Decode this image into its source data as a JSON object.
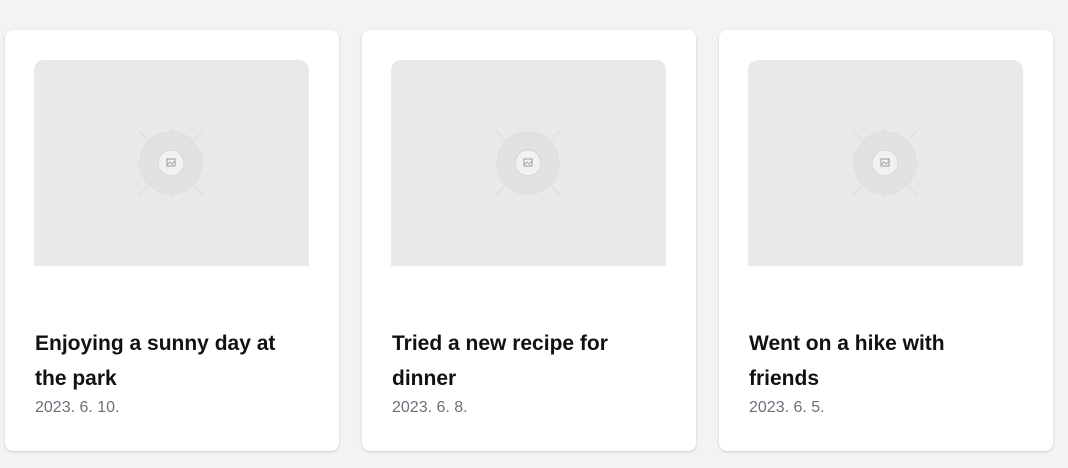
{
  "posts": [
    {
      "title": "Enjoying a sunny day at the park",
      "date": "2023. 6. 10.",
      "image_icon": "image-placeholder-icon"
    },
    {
      "title": "Tried a new recipe for dinner",
      "date": "2023. 6. 8.",
      "image_icon": "image-placeholder-icon"
    },
    {
      "title": "Went on a hike with friends",
      "date": "2023. 6. 5.",
      "image_icon": "image-placeholder-icon"
    }
  ],
  "colors": {
    "background": "#f2f3f5",
    "card": "#ffffff",
    "thumbnail": "#e9e9e9",
    "title": "#111111",
    "date": "#6b7079"
  }
}
